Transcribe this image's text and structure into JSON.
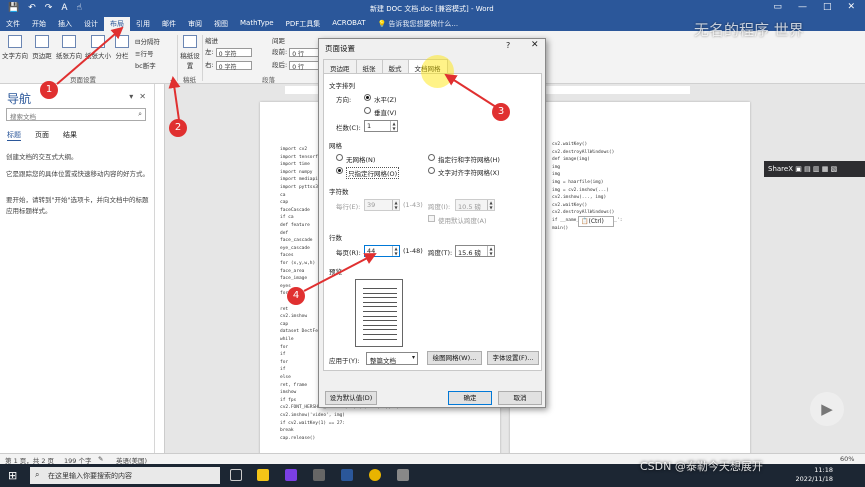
{
  "window": {
    "title": "新建 DOC 文档.doc [兼容模式] - Word"
  },
  "qat": {
    "save": "💾",
    "undo": "↶",
    "redo": "↷",
    "format_painter": "A",
    "touch": "☝"
  },
  "ribbon_tabs": [
    "文件",
    "开始",
    "插入",
    "设计",
    "布局",
    "引用",
    "邮件",
    "审阅",
    "视图",
    "MathType",
    "PDF工具集",
    "ACROBAT"
  ],
  "ribbon_active_tab": "布局",
  "tell_me": "告诉我您想要做什么...",
  "ribbon": {
    "buttons": [
      "文字方向",
      "页边距",
      "纸张方向",
      "纸张大小",
      "分栏"
    ],
    "breaks": "分隔符",
    "line_numbers": "行号",
    "hyphenation": "断字",
    "page_setup_group": "页面设置",
    "draft_paper": "稿纸设置",
    "draft_group": "稿纸",
    "indent": {
      "title": "缩进",
      "left_label": "左:",
      "left_value": "0 字符",
      "right_label": "右:",
      "right_value": "0 字符"
    },
    "spacing": {
      "title": "间距",
      "before_label": "段前:",
      "before_value": "0 行",
      "after_label": "段后:",
      "after_value": "0 行"
    },
    "paragraph_group": "段落"
  },
  "nav": {
    "title": "导航",
    "search_placeholder": "搜索文档",
    "tabs": [
      "标题",
      "页面",
      "结果"
    ],
    "para1": "创建文档的交互式大纲。",
    "para2": "它是跟踪您的具体位置或快速移动内容的好方式。",
    "para3": "要开始，请转到\"开始\"选项卡，并向文档中的标题应用标题样式。"
  },
  "doc_lines": [
    "import cv2",
    "import tensorflow",
    "import time",
    "import numpy",
    "import mediapipe",
    "import pyttsx3",
    "ca",
    "cap",
    "faceCascade",
    "if ca",
    "def feature",
    "def",
    "face_cascade",
    "eye_cascade",
    "faces",
    "for (x,y,w,h)",
    "face_area",
    "face_image",
    "eyes",
    "for",
    "",
    "ret",
    "cv2.imshow",
    "cap",
    "dataset DectFem",
    "while",
    "for",
    "if",
    "for",
    "if",
    "else",
    "ret, frame",
    "imshow",
    "if fps",
    "cv2.FONT_HERSHEY_SIMPLEX, 1, (0, 255, 0), 2)",
    "cv2.imshow('video', img)",
    "if cv2.waitKey(1) == 27:",
    "break",
    "cap.release()"
  ],
  "doc_lines_right": [
    "cv2.waitKey()",
    "cv2.destroyAllWindows()",
    "def image(img)",
    "img",
    "img",
    "img = haarfile(img)",
    "img = cv2.imshow(...)",
    "cv2.imshow(..., img)",
    "cv2.waitKey()",
    "cv2.destroyAllWindows()",
    "if __name__ == '__main__':",
    "main()"
  ],
  "paste_tag": "(Ctrl)",
  "sharex": "ShareX",
  "dialog": {
    "title": "页面设置",
    "help": "?",
    "close": "✕",
    "tabs": [
      "页边距",
      "纸张",
      "版式",
      "文档网格"
    ],
    "active_tab": "文档网格",
    "text_arrangement": "文字排列",
    "direction_label": "方向:",
    "horizontal": "水平(Z)",
    "vertical": "垂直(V)",
    "columns_label": "栏数(C):",
    "columns_value": "1",
    "grid_title": "网格",
    "grid_options": [
      "无网格(N)",
      "指定行和字符网格(H)",
      "只指定行网格(O)",
      "文字对齐字符网格(X)"
    ],
    "grid_selected": "只指定行网格(O)",
    "chars_title": "字符数",
    "per_line_label": "每行(E):",
    "per_line_value": "39",
    "per_line_range": "(1-43)",
    "pitch_label": "跨度(I):",
    "pitch_value": "10.5 磅",
    "use_default_pitch": "使用默认跨度(A)",
    "lines_title": "行数",
    "per_page_label": "每页(R):",
    "per_page_value": "44",
    "per_page_range": "(1-48)",
    "line_pitch_label": "跨度(T):",
    "line_pitch_value": "15.6 磅",
    "preview_title": "预览",
    "apply_to_label": "应用于(Y):",
    "apply_to_value": "整篇文档",
    "draw_grid": "绘图网格(W)...",
    "font_settings": "字体设置(F)...",
    "set_default": "设为默认值(D)",
    "ok": "确定",
    "cancel": "取消"
  },
  "annotations": [
    "1",
    "2",
    "3",
    "4"
  ],
  "annotation_color": "#e03030",
  "status": {
    "page": "第 1 页，共 2 页",
    "words": "199 个字",
    "lang": "英语(美国)",
    "zoom": "60%"
  },
  "taskbar": {
    "search_placeholder": "在这里输入你要搜索的内容",
    "time": "11:18",
    "date": "2022/11/18"
  },
  "watermarks": {
    "top": "无名的程序 世界",
    "csdn": "CSDN @泰勒今天想展开"
  },
  "colors": {
    "word_blue": "#2b579a",
    "highlight": "#ffe600"
  }
}
